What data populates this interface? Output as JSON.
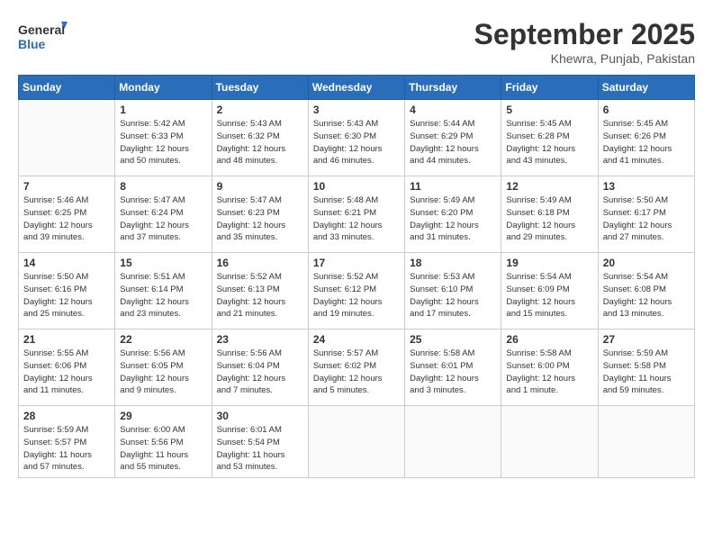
{
  "header": {
    "logo_line1": "General",
    "logo_line2": "Blue",
    "month_title": "September 2025",
    "location": "Khewra, Punjab, Pakistan"
  },
  "weekdays": [
    "Sunday",
    "Monday",
    "Tuesday",
    "Wednesday",
    "Thursday",
    "Friday",
    "Saturday"
  ],
  "weeks": [
    [
      {
        "day": "",
        "info": ""
      },
      {
        "day": "1",
        "info": "Sunrise: 5:42 AM\nSunset: 6:33 PM\nDaylight: 12 hours\nand 50 minutes."
      },
      {
        "day": "2",
        "info": "Sunrise: 5:43 AM\nSunset: 6:32 PM\nDaylight: 12 hours\nand 48 minutes."
      },
      {
        "day": "3",
        "info": "Sunrise: 5:43 AM\nSunset: 6:30 PM\nDaylight: 12 hours\nand 46 minutes."
      },
      {
        "day": "4",
        "info": "Sunrise: 5:44 AM\nSunset: 6:29 PM\nDaylight: 12 hours\nand 44 minutes."
      },
      {
        "day": "5",
        "info": "Sunrise: 5:45 AM\nSunset: 6:28 PM\nDaylight: 12 hours\nand 43 minutes."
      },
      {
        "day": "6",
        "info": "Sunrise: 5:45 AM\nSunset: 6:26 PM\nDaylight: 12 hours\nand 41 minutes."
      }
    ],
    [
      {
        "day": "7",
        "info": "Sunrise: 5:46 AM\nSunset: 6:25 PM\nDaylight: 12 hours\nand 39 minutes."
      },
      {
        "day": "8",
        "info": "Sunrise: 5:47 AM\nSunset: 6:24 PM\nDaylight: 12 hours\nand 37 minutes."
      },
      {
        "day": "9",
        "info": "Sunrise: 5:47 AM\nSunset: 6:23 PM\nDaylight: 12 hours\nand 35 minutes."
      },
      {
        "day": "10",
        "info": "Sunrise: 5:48 AM\nSunset: 6:21 PM\nDaylight: 12 hours\nand 33 minutes."
      },
      {
        "day": "11",
        "info": "Sunrise: 5:49 AM\nSunset: 6:20 PM\nDaylight: 12 hours\nand 31 minutes."
      },
      {
        "day": "12",
        "info": "Sunrise: 5:49 AM\nSunset: 6:18 PM\nDaylight: 12 hours\nand 29 minutes."
      },
      {
        "day": "13",
        "info": "Sunrise: 5:50 AM\nSunset: 6:17 PM\nDaylight: 12 hours\nand 27 minutes."
      }
    ],
    [
      {
        "day": "14",
        "info": "Sunrise: 5:50 AM\nSunset: 6:16 PM\nDaylight: 12 hours\nand 25 minutes."
      },
      {
        "day": "15",
        "info": "Sunrise: 5:51 AM\nSunset: 6:14 PM\nDaylight: 12 hours\nand 23 minutes."
      },
      {
        "day": "16",
        "info": "Sunrise: 5:52 AM\nSunset: 6:13 PM\nDaylight: 12 hours\nand 21 minutes."
      },
      {
        "day": "17",
        "info": "Sunrise: 5:52 AM\nSunset: 6:12 PM\nDaylight: 12 hours\nand 19 minutes."
      },
      {
        "day": "18",
        "info": "Sunrise: 5:53 AM\nSunset: 6:10 PM\nDaylight: 12 hours\nand 17 minutes."
      },
      {
        "day": "19",
        "info": "Sunrise: 5:54 AM\nSunset: 6:09 PM\nDaylight: 12 hours\nand 15 minutes."
      },
      {
        "day": "20",
        "info": "Sunrise: 5:54 AM\nSunset: 6:08 PM\nDaylight: 12 hours\nand 13 minutes."
      }
    ],
    [
      {
        "day": "21",
        "info": "Sunrise: 5:55 AM\nSunset: 6:06 PM\nDaylight: 12 hours\nand 11 minutes."
      },
      {
        "day": "22",
        "info": "Sunrise: 5:56 AM\nSunset: 6:05 PM\nDaylight: 12 hours\nand 9 minutes."
      },
      {
        "day": "23",
        "info": "Sunrise: 5:56 AM\nSunset: 6:04 PM\nDaylight: 12 hours\nand 7 minutes."
      },
      {
        "day": "24",
        "info": "Sunrise: 5:57 AM\nSunset: 6:02 PM\nDaylight: 12 hours\nand 5 minutes."
      },
      {
        "day": "25",
        "info": "Sunrise: 5:58 AM\nSunset: 6:01 PM\nDaylight: 12 hours\nand 3 minutes."
      },
      {
        "day": "26",
        "info": "Sunrise: 5:58 AM\nSunset: 6:00 PM\nDaylight: 12 hours\nand 1 minute."
      },
      {
        "day": "27",
        "info": "Sunrise: 5:59 AM\nSunset: 5:58 PM\nDaylight: 11 hours\nand 59 minutes."
      }
    ],
    [
      {
        "day": "28",
        "info": "Sunrise: 5:59 AM\nSunset: 5:57 PM\nDaylight: 11 hours\nand 57 minutes."
      },
      {
        "day": "29",
        "info": "Sunrise: 6:00 AM\nSunset: 5:56 PM\nDaylight: 11 hours\nand 55 minutes."
      },
      {
        "day": "30",
        "info": "Sunrise: 6:01 AM\nSunset: 5:54 PM\nDaylight: 11 hours\nand 53 minutes."
      },
      {
        "day": "",
        "info": ""
      },
      {
        "day": "",
        "info": ""
      },
      {
        "day": "",
        "info": ""
      },
      {
        "day": "",
        "info": ""
      }
    ]
  ]
}
